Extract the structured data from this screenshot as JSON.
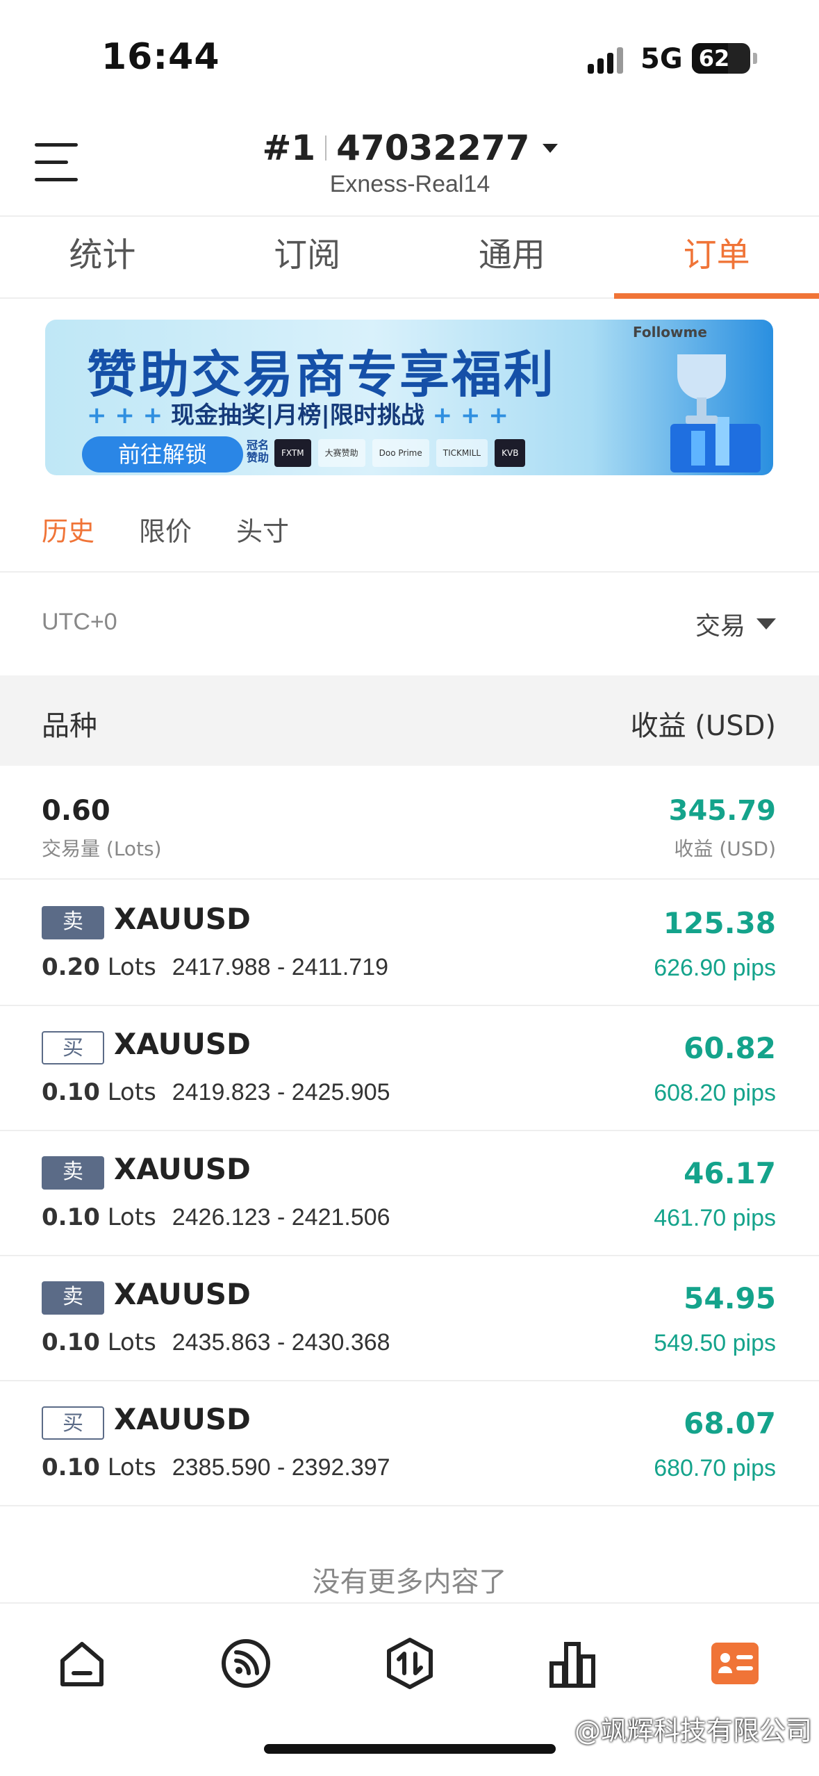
{
  "status_bar": {
    "time": "16:44",
    "network": "5G",
    "battery": "62",
    "battery_level": 0.62
  },
  "header": {
    "account_number": "#1",
    "account_id": "47032277",
    "server": "Exness-Real14"
  },
  "tabs": [
    {
      "label": "统计"
    },
    {
      "label": "订阅"
    },
    {
      "label": "通用"
    },
    {
      "label": "订单",
      "active": true
    }
  ],
  "banner": {
    "title": "赞助交易商专享福利",
    "subtitle": "现金抽奖|月榜|限时挑战",
    "cta": "前往解锁",
    "sponsor_label": "冠名赞助",
    "brand": "Followme",
    "logos": [
      "FXTM",
      "大赛赞助",
      "Doo Prime",
      "TICKMILL",
      "KVB"
    ]
  },
  "subtabs": [
    {
      "label": "历史",
      "active": true
    },
    {
      "label": "限价"
    },
    {
      "label": "头寸"
    }
  ],
  "filter": {
    "timezone": "UTC+0",
    "type": "交易"
  },
  "table_header": {
    "left": "品种",
    "right": "收益 (USD)"
  },
  "summary": {
    "lots": "0.60",
    "lots_label": "交易量 (Lots)",
    "profit": "345.79",
    "profit_label": "收益 (USD)"
  },
  "trades": [
    {
      "side": "卖",
      "side_type": "sell",
      "symbol": "XAUUSD",
      "lots": "0.20",
      "lots_unit": "Lots",
      "price_range": "2417.988 - 2411.719",
      "profit": "125.38",
      "pips": "626.90 pips"
    },
    {
      "side": "买",
      "side_type": "buy",
      "symbol": "XAUUSD",
      "lots": "0.10",
      "lots_unit": "Lots",
      "price_range": "2419.823 - 2425.905",
      "profit": "60.82",
      "pips": "608.20 pips"
    },
    {
      "side": "卖",
      "side_type": "sell",
      "symbol": "XAUUSD",
      "lots": "0.10",
      "lots_unit": "Lots",
      "price_range": "2426.123 - 2421.506",
      "profit": "46.17",
      "pips": "461.70 pips"
    },
    {
      "side": "卖",
      "side_type": "sell",
      "symbol": "XAUUSD",
      "lots": "0.10",
      "lots_unit": "Lots",
      "price_range": "2435.863 - 2430.368",
      "profit": "54.95",
      "pips": "549.50 pips"
    },
    {
      "side": "买",
      "side_type": "buy",
      "symbol": "XAUUSD",
      "lots": "0.10",
      "lots_unit": "Lots",
      "price_range": "2385.590 - 2392.397",
      "profit": "68.07",
      "pips": "680.70 pips"
    }
  ],
  "footer_text": "没有更多内容了",
  "bottom_nav": [
    {
      "icon": "home-icon"
    },
    {
      "icon": "feed-icon"
    },
    {
      "icon": "trade-icon"
    },
    {
      "icon": "chart-icon"
    },
    {
      "icon": "profile-card-icon",
      "active": true
    }
  ],
  "watermark": "@飒辉科技有限公司",
  "colors": {
    "accent": "#f07437",
    "profit": "#14a38b",
    "sell_badge": "#5b6b87"
  }
}
